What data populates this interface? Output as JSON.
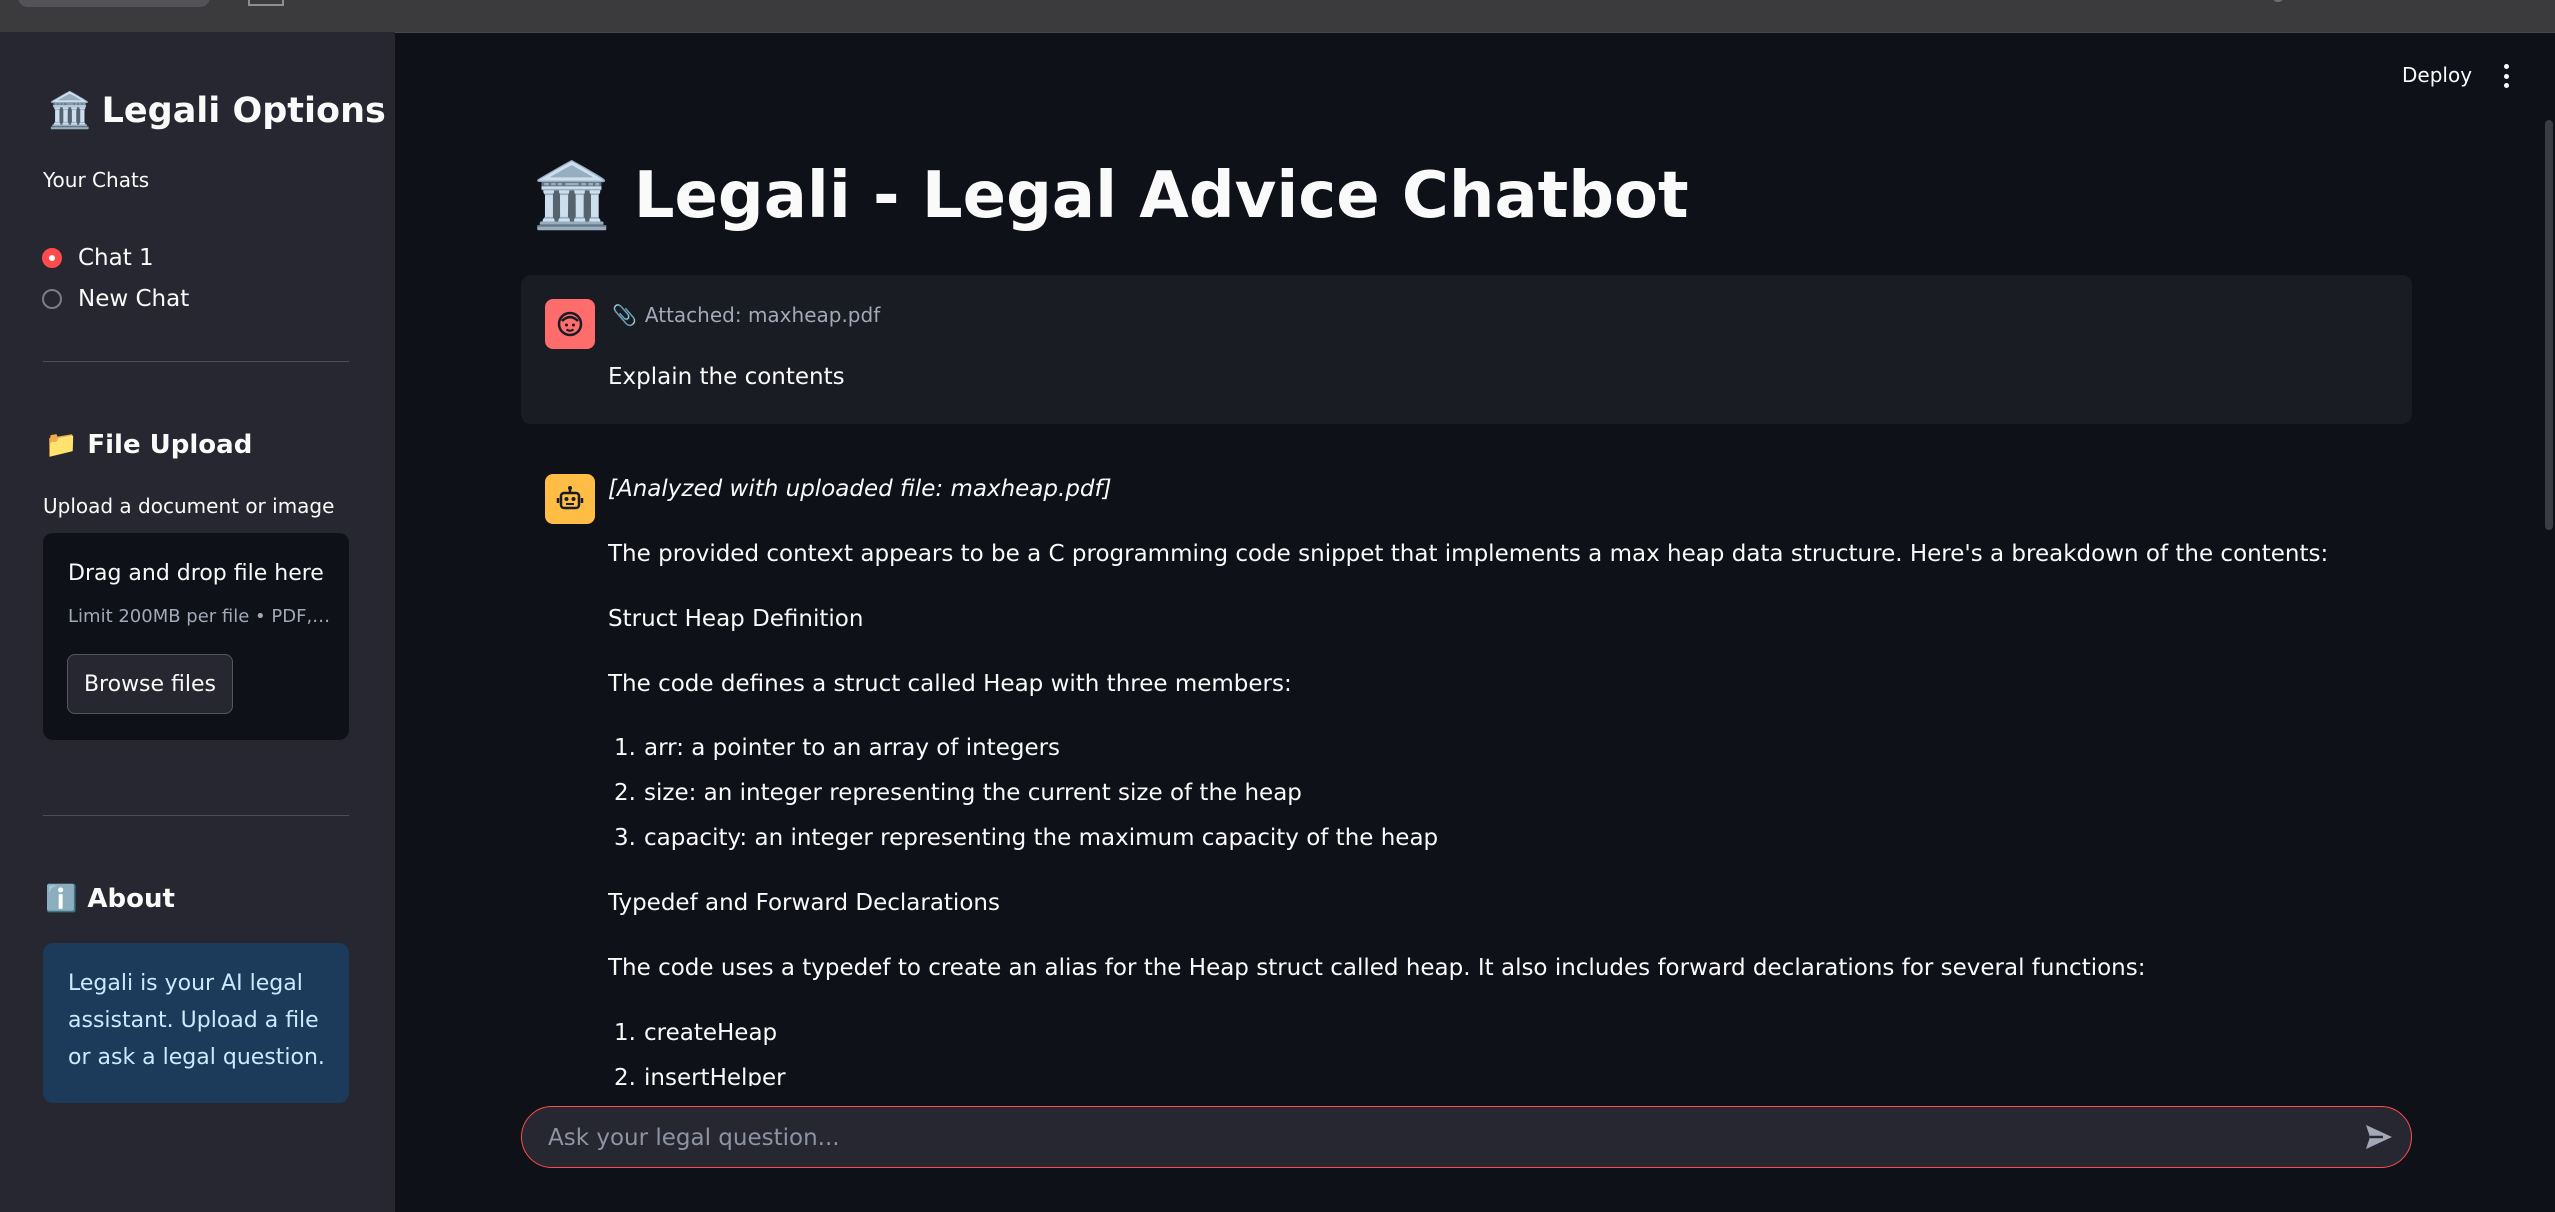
{
  "sidebar": {
    "title": "Legali Options",
    "chats_label": "Your Chats",
    "chats": [
      "Chat 1",
      "New Chat"
    ],
    "upload_heading": "File Upload",
    "upload_label": "Upload a document or image",
    "drop_title": "Drag and drop file here",
    "drop_limit": "Limit 200MB per file • PDF,…",
    "browse_label": "Browse files",
    "about_heading": "About",
    "about_text": "Legali is your AI legal assistant. Upload a file or ask a legal question."
  },
  "header": {
    "deploy_label": "Deploy"
  },
  "main": {
    "title": "Legali - Legal Advice Chatbot",
    "user_message": {
      "attachment": "Attached: maxheap.pdf",
      "text": "Explain the contents"
    },
    "bot_message": {
      "analyzed": "[Analyzed with uploaded file: maxheap.pdf]",
      "p1": "The provided context appears to be a C programming code snippet that implements a max heap data structure. Here's a breakdown of the contents:",
      "h1": "Struct Heap Definition",
      "p2": "The code defines a struct called Heap with three members:",
      "list1": [
        "arr: a pointer to an array of integers",
        "size: an integer representing the current size of the heap",
        "capacity: an integer representing the maximum capacity of the heap"
      ],
      "h2": "Typedef and Forward Declarations",
      "p3": "The code uses a typedef to create an alias for the Heap struct called heap. It also includes forward declarations for several functions:",
      "list2": [
        "createHeap",
        "insertHelper"
      ]
    }
  },
  "composer": {
    "placeholder": "Ask your legal question..."
  },
  "colors": {
    "accent": "#ff4b4b",
    "background": "#0e1117",
    "sidebar": "#262730",
    "user_avatar": "#ff6c6c",
    "bot_avatar": "#ffbd45"
  },
  "icons": {
    "title": "bank-icon",
    "upload": "folder-icon",
    "about": "info-icon",
    "attach": "paperclip-icon",
    "send": "send-icon"
  }
}
